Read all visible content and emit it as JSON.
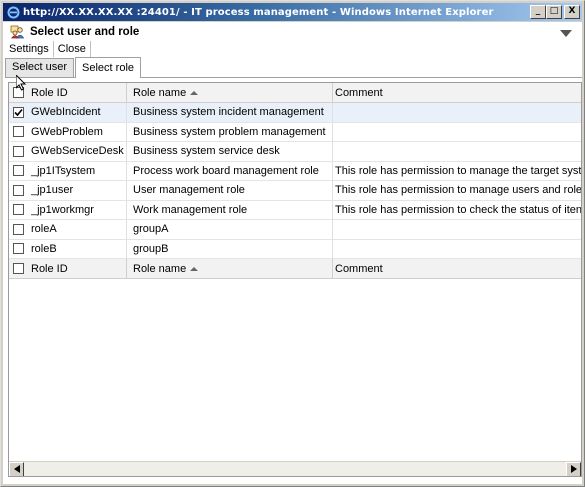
{
  "window": {
    "title": "http://XX.XX.XX.XX :24401/ - IT process management - Windows Internet Explorer",
    "minimize_label": "_",
    "maximize_label": "□",
    "close_label": "X"
  },
  "header": {
    "title": "Select user and role"
  },
  "menu": {
    "settings": "Settings",
    "close": "Close"
  },
  "tabs": [
    {
      "label": "Select user",
      "active": false
    },
    {
      "label": "Select role",
      "active": true
    }
  ],
  "table": {
    "columns": {
      "role_id": "Role ID",
      "role_name": "Role name",
      "comment": "Comment"
    },
    "rows": [
      {
        "checked": true,
        "role_id": "GWebIncident",
        "role_name": "Business system incident management",
        "comment": ""
      },
      {
        "checked": false,
        "role_id": "GWebProblem",
        "role_name": "Business system problem management",
        "comment": ""
      },
      {
        "checked": false,
        "role_id": "GWebServiceDesk",
        "role_name": "Business system service desk",
        "comment": ""
      },
      {
        "checked": false,
        "role_id": "_jp1ITsystem",
        "role_name": "Process work board management role",
        "comment": "This role has permission to manage the target syst"
      },
      {
        "checked": false,
        "role_id": "_jp1user",
        "role_name": "User management role",
        "comment": "This role has permission to manage users and role"
      },
      {
        "checked": false,
        "role_id": "_jp1workmgr",
        "role_name": "Work management role",
        "comment": "This role has permission to check the status of iten"
      },
      {
        "checked": false,
        "role_id": "roleA",
        "role_name": "groupA",
        "comment": ""
      },
      {
        "checked": false,
        "role_id": "roleB",
        "role_name": "groupB",
        "comment": ""
      }
    ]
  },
  "scrollbar": {
    "left_arrow": "◀",
    "right_arrow": "▶"
  },
  "icons": {
    "ie": "ie-icon",
    "app": "user-role-icon",
    "collapse": "chevron-down-icon",
    "sort": "sort-ascending-icon",
    "cursor": "mouse-pointer-icon"
  },
  "colors": {
    "titlebar": "#0a246a",
    "selected_row": "#e9f0fa"
  }
}
